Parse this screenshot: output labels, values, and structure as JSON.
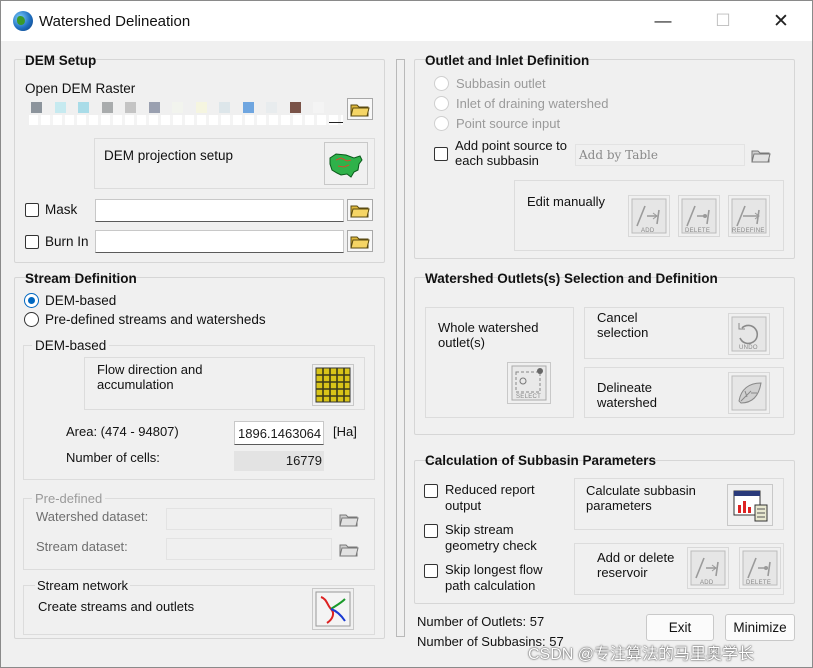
{
  "window": {
    "title": "Watershed Delineation"
  },
  "dem_setup": {
    "title": "DEM Setup",
    "open_label": "Open DEM Raster",
    "projection_label": "DEM projection setup",
    "mask_label": "Mask",
    "burnin_label": "Burn In",
    "swatch_colors": [
      "#8c949c",
      "#c6eaf0",
      "#a9dce8",
      "#a9acad",
      "#c4c4c4",
      "#9aa0b0",
      "#f2f4ee",
      "#f5f5e0",
      "#dde6ea",
      "#6fa6e0",
      "#e8ecee",
      "#7a5348",
      "#f4f4f4"
    ]
  },
  "stream_definition": {
    "title": "Stream Definition",
    "options": [
      "DEM-based",
      "Pre-defined streams and watersheds"
    ],
    "dem_based": {
      "title": "DEM-based",
      "flow_label": "Flow direction and accumulation",
      "area_label": "Area: (474 - 94807)",
      "area_value": "1896.1463064",
      "area_unit": "[Ha]",
      "cells_label": "Number of cells:",
      "cells_value": "16779"
    },
    "predefined": {
      "title": "Pre-defined",
      "watershed_label": "Watershed dataset:",
      "stream_label": "Stream dataset:"
    },
    "stream_network": {
      "title": "Stream network",
      "create_label": "Create streams and outlets"
    }
  },
  "outlet_inlet": {
    "title": "Outlet and Inlet Definition",
    "options": [
      "Subbasin outlet",
      "Inlet of draining watershed",
      "Point source input"
    ],
    "add_point_label": "Add point source to each subbasin",
    "add_by_table": "Add by Table",
    "edit_manually": "Edit manually",
    "icon_labels": [
      "ADD",
      "DELETE",
      "REDEFINE"
    ]
  },
  "watershed_outlets": {
    "title": "Watershed Outlets(s) Selection and Definition",
    "whole_label": "Whole watershed outlet(s)",
    "cancel_label": "Cancel selection",
    "delineate_label": "Delineate watershed",
    "icon_labels": [
      "SELECT",
      "UNDO"
    ]
  },
  "subbasin_params": {
    "title": "Calculation of Subbasin Parameters",
    "reduced_label": "Reduced  report output",
    "skip_stream_label": "Skip stream geometry check",
    "skip_longest_label": "Skip longest flow path calculation",
    "calc_label": "Calculate subbasin parameters",
    "reservoir_label": "Add or delete reservoir",
    "icon_labels": [
      "ADD",
      "DELETE"
    ]
  },
  "status": {
    "outlets": "Number of Outlets: 57",
    "subbasins": "Number of Subbasins: 57"
  },
  "buttons": {
    "exit": "Exit",
    "minimize": "Minimize"
  },
  "watermark": "CSDN @专注算法的马里奥学长"
}
